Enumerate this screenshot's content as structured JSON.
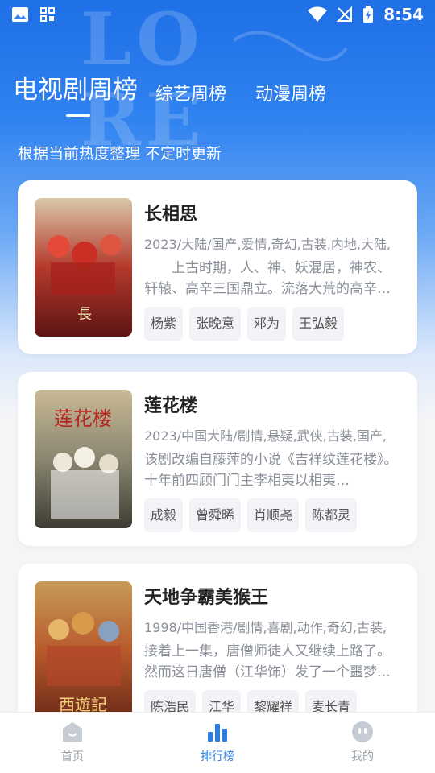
{
  "status": {
    "time": "8:54"
  },
  "tabs": [
    {
      "label": "电视剧周榜"
    },
    {
      "label": "综艺周榜"
    },
    {
      "label": "动漫周榜"
    }
  ],
  "subtitle": "根据当前热度整理 不定时更新",
  "cards": [
    {
      "title": "长相思",
      "meta": "2023/大陆/国产,爱情,奇幻,古装,内地,大陆,",
      "desc": "　　上古时期，人、神、妖混居，神农、轩辕、高辛三国鼎立。流落大荒的高辛…",
      "tags": [
        "杨紫",
        "张晚意",
        "邓为",
        "王弘毅"
      ]
    },
    {
      "title": "莲花楼",
      "meta": "2023/中国大陆/剧情,悬疑,武侠,古装,国产,",
      "desc": "该剧改编自藤萍的小说《吉祥纹莲花楼》。十年前四顾门门主李相夷以相夷…",
      "tags": [
        "成毅",
        "曾舜晞",
        "肖顺尧",
        "陈都灵"
      ]
    },
    {
      "title": "天地争霸美猴王",
      "meta": "1998/中国香港/剧情,喜剧,动作,奇幻,古装,",
      "desc": "接着上一集，唐僧师徒人又继续上路了。然而这日唐僧（江华饰）发了一个噩梦…",
      "tags": [
        "陈浩民",
        "江华",
        "黎耀祥",
        "麦长青"
      ]
    }
  ],
  "nav": [
    {
      "label": "首页"
    },
    {
      "label": "排行榜"
    },
    {
      "label": "我的"
    }
  ]
}
